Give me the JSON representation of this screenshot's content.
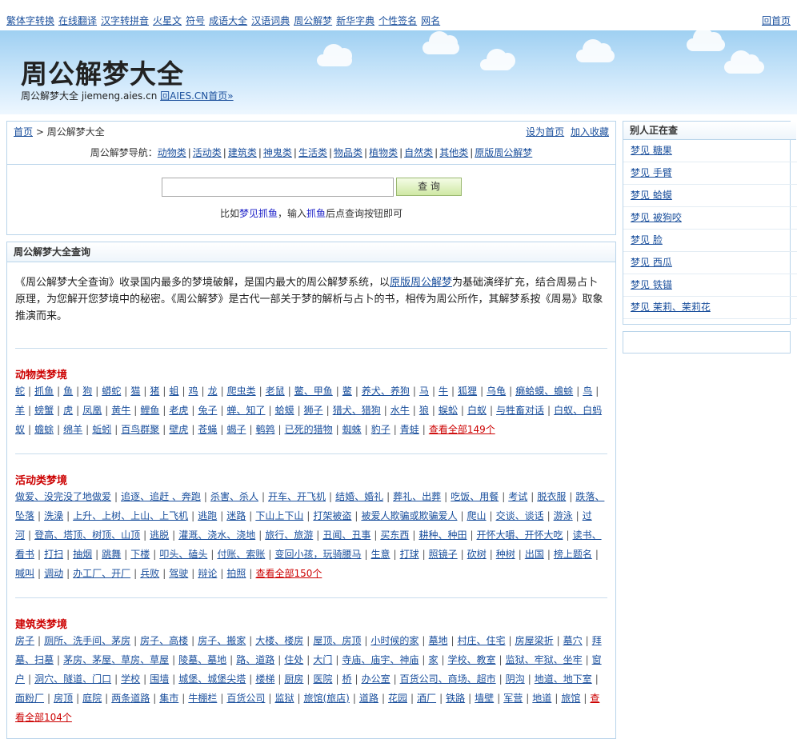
{
  "topnav": {
    "links": [
      "繁体字转换",
      "在线翻译",
      "汉字转拼音",
      "火星文",
      "符号",
      "成语大全",
      "汉语词典",
      "周公解梦",
      "新华字典",
      "个性签名",
      "网名"
    ],
    "home": "回首页"
  },
  "header": {
    "title": "周公解梦大全",
    "subtitle_prefix": "周公解梦大全 jiemeng.aies.cn",
    "subtitle_link": "回AIES.CN首页»"
  },
  "breadcrumb": {
    "home": "首页",
    "separator": ">",
    "current": "周公解梦大全",
    "set_home": "设为首页",
    "bookmark": "加入收藏"
  },
  "dream_nav": {
    "label": "周公解梦导航：",
    "items": [
      "动物类",
      "活动类",
      "建筑类",
      "神鬼类",
      "生活类",
      "物品类",
      "植物类",
      "自然类",
      "其他类",
      "原版周公解梦"
    ]
  },
  "search": {
    "placeholder": "",
    "button": "查 询",
    "hint_prefix": "比如",
    "hint_link1": "梦见抓鱼",
    "hint_mid": "，输入",
    "hint_link2": "抓鱼",
    "hint_suffix": "后点查询按钮即可"
  },
  "main": {
    "title": "周公解梦大全查询",
    "intro_1": "《周公解梦大全查询》收录国内最多的梦境破解，是国内最大的周公解梦系统，以",
    "intro_link": "原版周公解梦",
    "intro_2": "为基础演绎扩充，结合周易占卜原理，为您解开您梦境中的秘密。《周公解梦》是古代一部关于梦的解析与占卜的书，相传为周公所作，其解梦系按《周易》取象推演而来。"
  },
  "categories": [
    {
      "title": "动物类梦境",
      "items": [
        "蛇",
        "抓鱼",
        "鱼",
        "狗",
        "蟒蛇",
        "猫",
        "猪",
        "蛆",
        "鸡",
        "龙",
        "爬虫类",
        "老鼠",
        "鳖、甲鱼",
        "鳖",
        "养犬、养狗",
        "马",
        "牛",
        "狐狸",
        "乌龟",
        "癞蛤蟆、蟾蜍",
        "鸟",
        "羊",
        "螃蟹",
        "虎",
        "凤凰",
        "黄牛",
        "鲤鱼",
        "老虎",
        "兔子",
        "蝉、知了",
        "蛤蟆",
        "狮子",
        "猎犬、猎狗",
        "水牛",
        "狼",
        "蜈蚣",
        "白蚁",
        "与牲畜对话",
        "白蚁、白蚂蚁",
        "蟾蜍",
        "绵羊",
        "蚯蚓",
        "百鸟群聚",
        "壁虎",
        "苍蝇",
        "蝎子",
        "鹌鹑",
        "已死的猎物",
        "蜘蛛",
        "豹子",
        "青蛙"
      ],
      "more": "查看全部149个"
    },
    {
      "title": "活动类梦境",
      "items": [
        "做爱、没完没了地做爱",
        "追逐、追赶 、奔跑",
        "杀害、杀人",
        "开车、开飞机",
        "结婚、婚礼",
        "葬礼、出葬",
        "吃饭、用餐",
        "考试",
        "脱衣服",
        "跌落、坠落",
        "洗澡",
        "上升、上树、上山、上飞机",
        "逃跑",
        "迷路",
        "下山上下山",
        "打架被盗",
        "被爱人欺骗或欺骗爱人",
        "爬山",
        "交谈、谈话",
        "游泳",
        "过河",
        "登高、塔顶、树顶、山顶",
        "逃脱",
        "灌溉、浇水、浇地",
        "旅行、旅游",
        "丑闻、丑事",
        "买东西",
        "耕种、种田",
        "开怀大嚼、开怀大吃",
        "读书、看书",
        "打扫",
        "抽烟",
        "跳舞",
        "下楼",
        "叩头、磕头",
        "付账、索账",
        "变回小孩，玩骑腰马",
        "生意",
        "打球",
        "照镜子",
        "砍树",
        "种树",
        "出国",
        "榜上题名",
        "喊叫",
        "调动",
        "办工厂、开厂",
        "兵败",
        "驾驶",
        "辩论",
        "拍照"
      ],
      "more": "查看全部150个"
    },
    {
      "title": "建筑类梦境",
      "items": [
        "房子",
        "厕所、洗手间、茅房",
        "房子、高楼",
        "房子、搬家",
        "大楼、楼房",
        "屋顶、房顶",
        "小时候的家",
        "墓地",
        "村庄、住宅",
        "房屋梁折",
        "墓穴",
        "拜墓、扫墓",
        "茅房、茅屋、草房、草屋",
        "陵墓、墓地",
        "路、道路",
        "住处",
        "大门",
        "寺庙、庙宇、神庙",
        "家",
        "学校、教室",
        "监狱、牢狱、坐牢",
        "窗户",
        "洞穴、隧道、门口",
        "学校",
        "围墙",
        "城堡、城堡尖塔",
        "楼梯",
        "厨房",
        "医院",
        "桥",
        "办公室",
        "百货公司、商场、超市",
        "阴沟",
        "地道、地下室",
        "面粉厂",
        "房顶",
        "庭院",
        "两条道路",
        "集市",
        "牛棚栏",
        "百货公司",
        "监狱",
        "旅馆(旅店)",
        "道路",
        "花园",
        "酒厂",
        "铁路",
        "墙壁",
        "军营",
        "地道",
        "旅馆"
      ],
      "more": "查看全部104个"
    }
  ],
  "sidebar": {
    "title": "别人正在查",
    "items": [
      "梦见 糖果",
      "梦见 手臂",
      "梦见 蛤蟆",
      "梦见 被狗咬",
      "梦见 脸",
      "梦见 西瓜",
      "梦见 铁锚",
      "梦见 茉莉、茉莉花"
    ]
  }
}
